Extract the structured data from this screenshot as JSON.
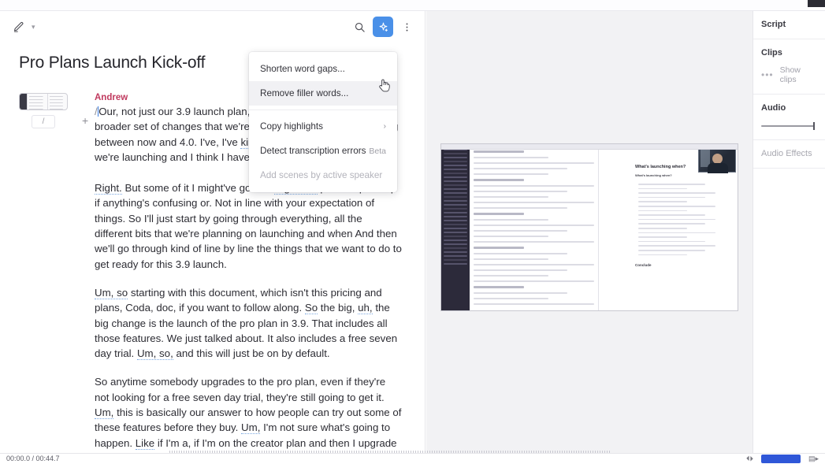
{
  "toolbar": {
    "edit_icon": "pencil-icon",
    "edit_dropdown_caret": "▾",
    "search_icon": "search-icon",
    "ai_icon": "ai-sparkle-icon",
    "more_icon": "three-dot-menu-icon"
  },
  "document": {
    "title": "Pro Plans Launch Kick-off",
    "speaker": "Andrew",
    "scene_slash_label": "/",
    "scene_add_label": "+",
    "paragraphs": [
      {
        "id": "p1",
        "text": "/Our, not just our 3.9 launch plan, but also kind of some of the broader set of changes that we're making to our plans and pricing between now and 4.0. I've, I've kind of written an outline of what we're launching and I think I have most of it."
      },
      {
        "id": "p2",
        "text": "Right. But some of it I might've gotten. Right. So please speak up if anything's confusing or. Not in line with your expectation of things. So I'll just start by going through everything, all the different bits that we're planning on launching and when And then we'll go through kind of line by line the things that we want to do to get ready for this 3.9 launch."
      },
      {
        "id": "p3",
        "text": "Um, so starting with this document, which isn't this pricing and plans, Coda, doc, if you want to follow along. So the big, uh, the big change is the launch of the pro plan in 3.9. That includes all those features. We just talked about. It also includes a free seven day trial. Um, so, and this will just be on by default."
      },
      {
        "id": "p4",
        "text": "So anytime somebody upgrades to the pro plan, even if they're not looking for a free seven day trial, they're still going to get it. Um, this is basically our answer to how people can try out some of these features before they buy. Um, I'm not sure what's going to happen. Like if I'm a, if I'm on the creator plan and then I upgrade with a free seven day trial."
      }
    ]
  },
  "menu": {
    "items": [
      {
        "label": "Shorten word gaps...",
        "state": "normal",
        "trailing": ""
      },
      {
        "label": "Remove filler words...",
        "state": "hovered",
        "trailing": ""
      },
      {
        "label": "Copy highlights",
        "state": "normal",
        "trailing": "›"
      },
      {
        "label": "Detect transcription errors",
        "state": "normal",
        "trailing": "Beta"
      },
      {
        "label": "Add scenes by active speaker",
        "state": "disabled",
        "trailing": ""
      }
    ]
  },
  "sidebar": {
    "sections": [
      {
        "title": "Script",
        "muted": false
      },
      {
        "title": "Clips",
        "muted": false
      },
      {
        "title": "Audio",
        "muted": false
      },
      {
        "title": "Audio Effects",
        "muted": true
      }
    ],
    "clips": {
      "dots_icon": "more-options-icon",
      "show_clips_label": "Show clips"
    },
    "audio": {
      "volume_percent": 100
    }
  },
  "bottom_bar": {
    "timecode": "00:00.0 / 00:44.7",
    "playback_icon": "playhead-icon",
    "export_button_label": "",
    "right_icon": "layers-icon"
  },
  "preview": {
    "screen_share_title": "What's launching when?",
    "screen_share_subtitle": "What's launching when?",
    "screen_share_footer": "Conclude",
    "camera_label": "participant-video"
  },
  "colors": {
    "accent_blue": "#4a90e8",
    "speaker_pink": "#c0395e",
    "filler_underline": "#7ba7e0",
    "export_blue": "#2f57d8"
  }
}
